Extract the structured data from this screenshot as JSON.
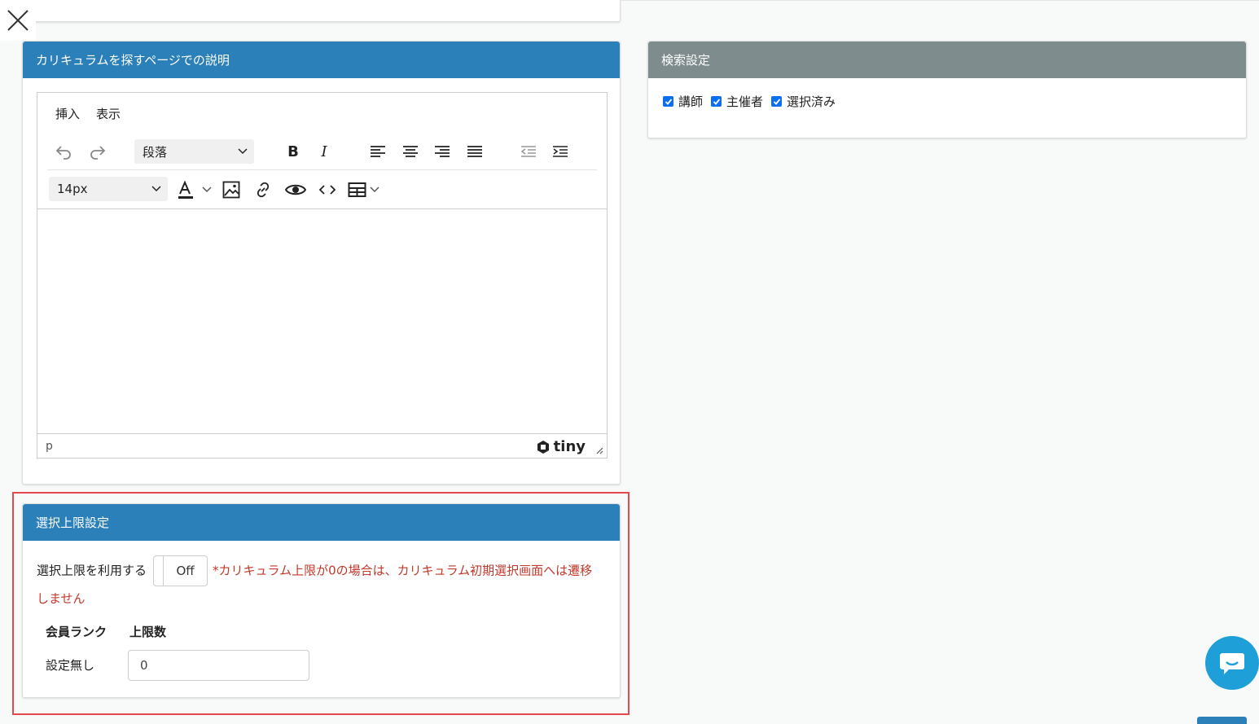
{
  "description_panel": {
    "title": "カリキュラムを探すページでの説明",
    "menu": [
      "挿入",
      "表示"
    ],
    "block_format": "段落",
    "font_size": "14px",
    "status_path": "p",
    "brand": "tiny"
  },
  "search_settings": {
    "title": "検索設定",
    "options": [
      {
        "label": "講師",
        "checked": true
      },
      {
        "label": "主催者",
        "checked": true
      },
      {
        "label": "選択済み",
        "checked": true
      }
    ]
  },
  "limit_settings": {
    "title": "選択上限設定",
    "use_limit_label": "選択上限を利用する",
    "toggle_label": "Off",
    "warning": "*カリキュラム上限が0の場合は、カリキュラム初期選択画面へは遷移しません",
    "col_rank": "会員ランク",
    "col_limit": "上限数",
    "rows": [
      {
        "rank": "設定無し",
        "limit": "0"
      }
    ]
  },
  "colors": {
    "header_blue": "#2b80b9",
    "header_gray": "#7f8c8d",
    "warning_red": "#c0392b",
    "highlight_red": "#e5484d",
    "chat_blue": "#1e9fd8"
  }
}
